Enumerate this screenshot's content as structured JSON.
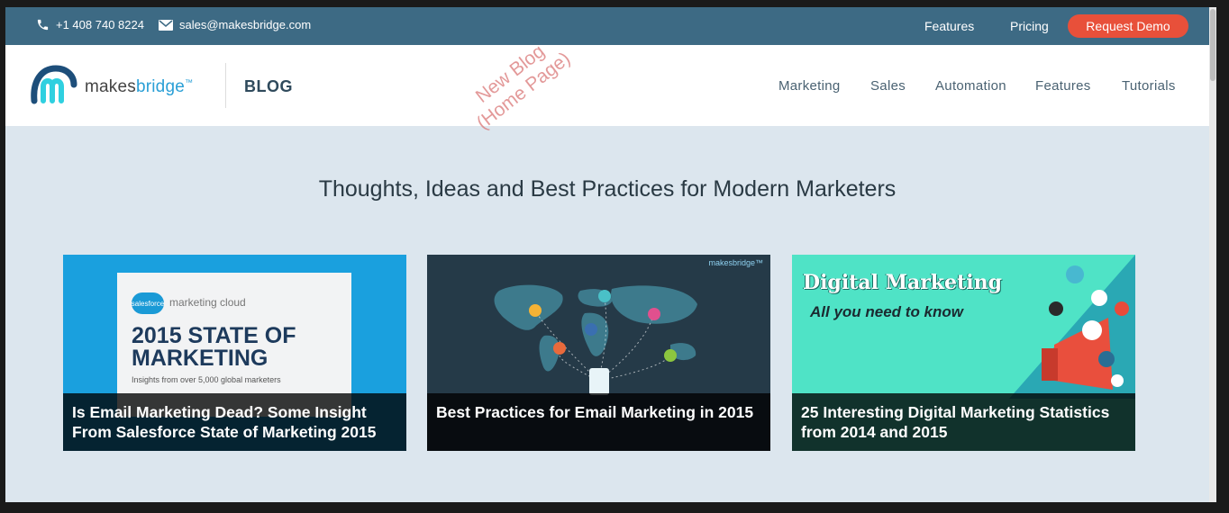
{
  "topbar": {
    "phone": "+1 408 740 8224",
    "email": "sales@makesbridge.com",
    "links": [
      "Features",
      "Pricing"
    ],
    "cta": "Request Demo"
  },
  "header": {
    "logo_text_a": "makes",
    "logo_text_b": "bridge",
    "logo_tm": "™",
    "blog_label": "BLOG",
    "nav": [
      "Marketing",
      "Sales",
      "Automation",
      "Features",
      "Tutorials"
    ]
  },
  "watermark": {
    "line1": "New Blog",
    "line2": "(Home Page)"
  },
  "tagline": "Thoughts, Ideas and Best Practices for Modern Marketers",
  "cards": [
    {
      "title": "Is Email Marketing Dead? Some Insight From Salesforce State of Marketing 2015",
      "img_badge": "salesforce",
      "img_brand": "marketing cloud",
      "img_title": "2015 STATE OF MARKETING",
      "img_sub": "Insights from over 5,000 global marketers"
    },
    {
      "title": "Best Practices for Email Marketing in 2015",
      "img_brand": "makesbridge™"
    },
    {
      "title": "25 Interesting Digital Marketing Statistics from 2014 and 2015",
      "img_title": "Digital Marketing",
      "img_sub": "All you need to know"
    }
  ],
  "colors": {
    "topbar": "#3d6a84",
    "cta": "#e8503a",
    "accent": "#2a9fd6",
    "page_bg": "#dce6ee"
  }
}
